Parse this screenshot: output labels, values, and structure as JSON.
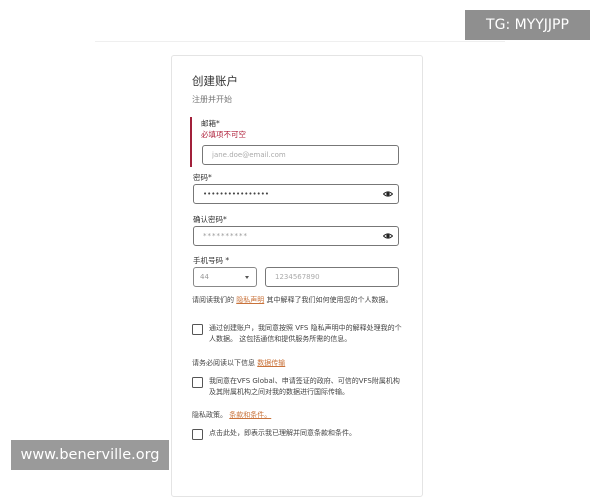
{
  "form": {
    "title": "创建账户",
    "subtitle": "注册并开始",
    "email": {
      "label": "邮箱*",
      "error": "必填项不可空",
      "placeholder": "jane.doe@email.com"
    },
    "password": {
      "label": "密码*",
      "value": "••••••••••••••••"
    },
    "confirm_password": {
      "label": "确认密码*",
      "placeholder": "**********"
    },
    "phone": {
      "label": "手机号码 *",
      "country_code": "44",
      "placeholder": "1234567890"
    },
    "privacy_notice": {
      "text_before": "请阅读我们的 ",
      "link": "隐私声明",
      "text_after": " 其中解释了我们如何使用您的个人数据。"
    },
    "consent_1": "通过创建账户，我同意按照 VFS 隐私声明中的解释处理我的个人数据。 这包括通信和提供服务所需的信息。",
    "transfer_notice": {
      "text_before": "请务必阅读以下信息 ",
      "link": "数据传输"
    },
    "consent_2": "我同意在VFS Global、申请签证的政府、可信的VFS附属机构及其附属机构之间对我的数据进行国际传输。",
    "privacy_policy": {
      "text_before": "隐私政策。 ",
      "link": "条款和条件。"
    },
    "consent_3": "点击此处，即表示我已理解并同意条款和条件。"
  },
  "watermarks": {
    "tg": "TG: MYYJJPP",
    "url": "www.benerville.org"
  },
  "colors": {
    "error": "#b0233d",
    "link": "#c9733b"
  },
  "icons": {
    "password_toggle": "eye-icon",
    "dropdown": "chevron-down-icon"
  }
}
